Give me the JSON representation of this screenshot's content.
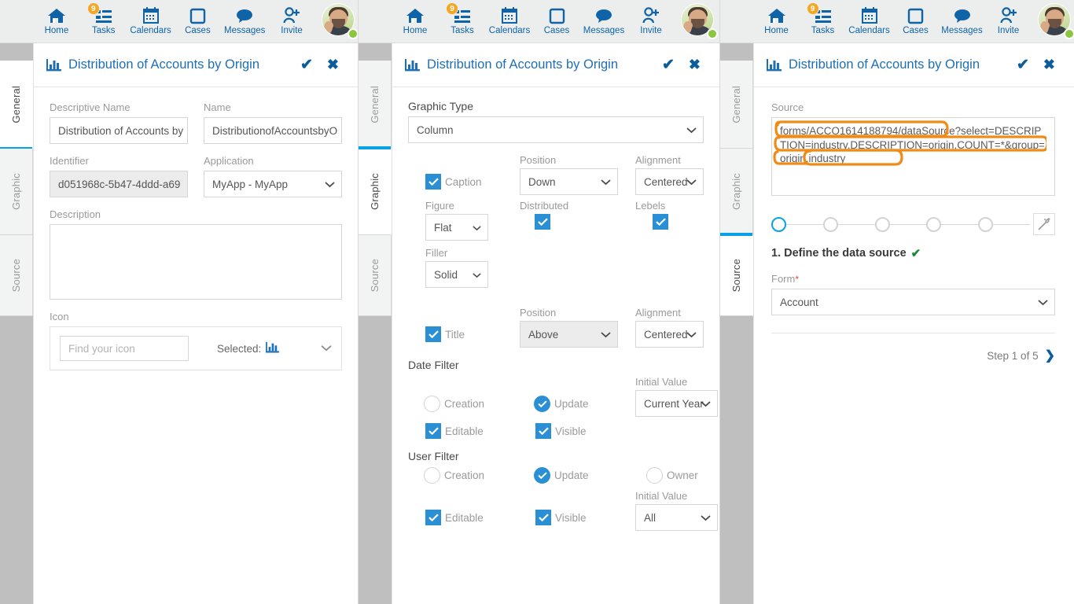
{
  "colors": {
    "accent_blue": "#1f6fb4",
    "nav_blue": "#0f64a8",
    "checkbox_blue": "#2a8fd4",
    "tab_underline": "#0aa0e6",
    "badge_orange": "#f5a623",
    "annotation_orange": "#ef8b16",
    "status_green": "#8cc63e",
    "check_green": "#1a8a3a",
    "required_red": "#e24b3a"
  },
  "topnav": {
    "items": [
      {
        "label": "Home",
        "icon": "home-icon",
        "badge": null
      },
      {
        "label": "Tasks",
        "icon": "tasks-icon",
        "badge": "9"
      },
      {
        "label": "Calendars",
        "icon": "calendar-icon",
        "badge": null
      },
      {
        "label": "Cases",
        "icon": "cases-icon",
        "badge": null
      },
      {
        "label": "Messages",
        "icon": "message-bubble-icon",
        "badge": null
      },
      {
        "label": "Invite",
        "icon": "invite-person-icon",
        "badge": null
      }
    ],
    "avatar": {
      "name": "user-avatar",
      "status": "online"
    }
  },
  "card": {
    "title": "Distribution of Accounts by Origin",
    "icon": "bar-chart-icon",
    "confirm_label": "✔",
    "close_label": "✖"
  },
  "tabs": [
    {
      "label": "General"
    },
    {
      "label": "Graphic"
    },
    {
      "label": "Source"
    }
  ],
  "panel1": {
    "active_tab": "General",
    "descriptive_name": {
      "label": "Descriptive Name",
      "value": "Distribution of Accounts by"
    },
    "name": {
      "label": "Name",
      "value": "DistributionofAccountsbyO"
    },
    "identifier": {
      "label": "Identifier",
      "value": "d051968c-5b47-4ddd-a69"
    },
    "application": {
      "label": "Application",
      "value": "MyApp - MyApp"
    },
    "description": {
      "label": "Description",
      "value": ""
    },
    "icon_section": {
      "label": "Icon",
      "search_placeholder": "Find your icon",
      "selected_label": "Selected:",
      "selected_icon": "bar-chart-icon"
    }
  },
  "panel2": {
    "active_tab": "Graphic",
    "graphic_type": {
      "label": "Graphic Type",
      "value": "Column"
    },
    "caption": {
      "label": "Caption",
      "checked": true,
      "position_label": "Position",
      "position_value": "Down",
      "alignment_label": "Alignment",
      "alignment_value": "Centered"
    },
    "figure": {
      "label": "Figure",
      "value": "Flat"
    },
    "distributed": {
      "label": "Distributed",
      "checked": true
    },
    "lebels": {
      "label": "Lebels",
      "checked": true
    },
    "filler": {
      "label": "Filler",
      "value": "Solid"
    },
    "title": {
      "label": "Title",
      "checked": true,
      "position_label": "Position",
      "position_value": "Above",
      "alignment_label": "Alignment",
      "alignment_value": "Centered"
    },
    "date_filter": {
      "heading": "Date Filter",
      "creation": {
        "label": "Creation",
        "selected": false
      },
      "update": {
        "label": "Update",
        "selected": true
      },
      "initial_value_label": "Initial Value",
      "initial_value": "Current Year",
      "editable": {
        "label": "Editable",
        "checked": true
      },
      "visible": {
        "label": "Visible",
        "checked": true
      }
    },
    "user_filter": {
      "heading": "User Filter",
      "creation": {
        "label": "Creation",
        "selected": false
      },
      "update": {
        "label": "Update",
        "selected": true
      },
      "owner": {
        "label": "Owner",
        "selected": false
      },
      "initial_value_label": "Initial Value",
      "initial_value": "All",
      "editable": {
        "label": "Editable",
        "checked": true
      },
      "visible": {
        "label": "Visible",
        "checked": true
      }
    }
  },
  "panel3": {
    "active_tab": "Source",
    "source": {
      "label": "Source",
      "value": "forms/ACCO1614188794/dataSource?select=DESCRIPTION=industry,DESCRIPTION=origin,COUNT=*&group=origin,industry",
      "line1": "forms/ACCO1614188794/dataSource?",
      "line2": "select=DESCRIPTION=industry,DESCRIPTION=origin,COU",
      "line3a": "NT=*&",
      "line3b": "group=origin,industry"
    },
    "wizard": {
      "total_steps": 5,
      "current_step": 1,
      "wand_icon": "magic-wand-icon"
    },
    "step_title": "1. Define the data source",
    "step_done_mark": "✔",
    "form": {
      "label": "Form",
      "value": "Account",
      "required": true
    },
    "step_nav": {
      "label": "Step 1 of 5",
      "arrow": "❯"
    }
  }
}
